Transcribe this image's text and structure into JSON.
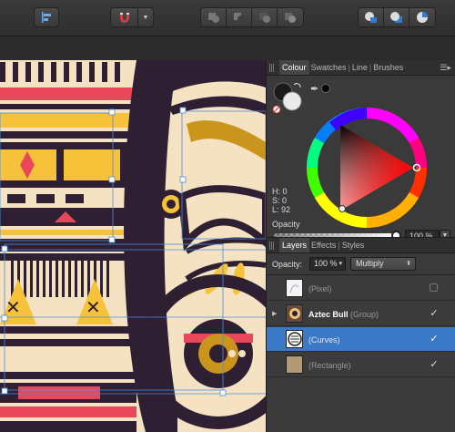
{
  "toolbar": {
    "icons": [
      "align-left-icon",
      "snapping-magnet-icon",
      "dropdown-chevron-icon",
      "boolean-add-icon",
      "boolean-subtract-icon",
      "boolean-intersect-icon",
      "boolean-divide-icon",
      "arrange-back-icon",
      "arrange-front-icon",
      "arrange-forward-icon"
    ]
  },
  "colour_panel": {
    "tabs": [
      "Colour",
      "Swatches",
      "Line",
      "Brushes"
    ],
    "hsl": {
      "h": "H: 0",
      "s": "S: 0",
      "l": "L: 92"
    },
    "opacity_label": "Opacity",
    "opacity_value": "100 %",
    "opacity_fraction": 1.0
  },
  "layers_panel": {
    "tabs": [
      "Layers",
      "Effects",
      "Styles"
    ],
    "opacity_label": "Opacity:",
    "opacity_value": "100 %",
    "blend_mode": "Multiply",
    "layers": [
      {
        "name": "(Pixel)",
        "group_suffix": "",
        "bold": false,
        "visible": false,
        "selected": false
      },
      {
        "name": "Aztec Bull",
        "group_suffix": "(Group)",
        "bold": true,
        "visible": true,
        "selected": false
      },
      {
        "name": "(Curves)",
        "group_suffix": "",
        "bold": false,
        "visible": true,
        "selected": true
      },
      {
        "name": "(Rectangle)",
        "group_suffix": "",
        "bold": false,
        "visible": true,
        "selected": false
      }
    ]
  },
  "colors": {
    "accent": "#3a78c8",
    "canvas_dark": "#2e1f33",
    "canvas_red": "#e8485a",
    "canvas_yellow": "#f5c23a",
    "canvas_cream": "#f4e2c2"
  }
}
